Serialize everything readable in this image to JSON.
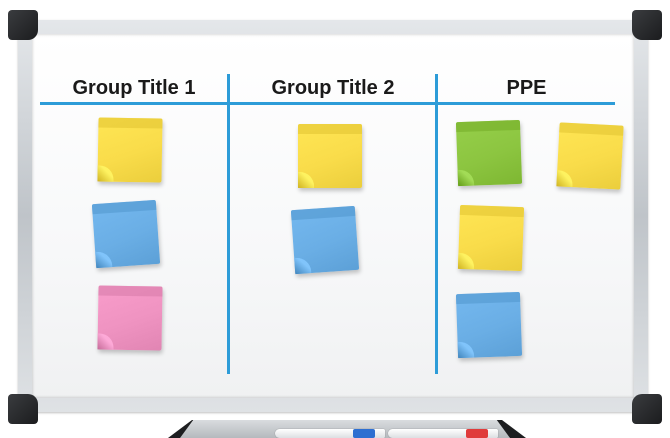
{
  "columns": [
    {
      "title": "Group Title 1"
    },
    {
      "title": "Group Title 2"
    },
    {
      "title": "PPE"
    }
  ],
  "colors": {
    "divider": "#2d9cd8",
    "yellow": "#f9dc4a",
    "blue": "#6aaee5",
    "pink": "#ef93c1",
    "green": "#8cc540",
    "marker_blue": "#2d6fd1",
    "marker_red": "#e03b3b"
  },
  "notes": [
    {
      "column": 0,
      "color": "yellow"
    },
    {
      "column": 0,
      "color": "blue"
    },
    {
      "column": 0,
      "color": "pink"
    },
    {
      "column": 1,
      "color": "yellow"
    },
    {
      "column": 1,
      "color": "blue"
    },
    {
      "column": 2,
      "color": "green"
    },
    {
      "column": 2,
      "color": "yellow"
    },
    {
      "column": 2,
      "color": "yellow"
    },
    {
      "column": 2,
      "color": "blue"
    }
  ],
  "markers": [
    {
      "color": "blue"
    },
    {
      "color": "red"
    }
  ]
}
